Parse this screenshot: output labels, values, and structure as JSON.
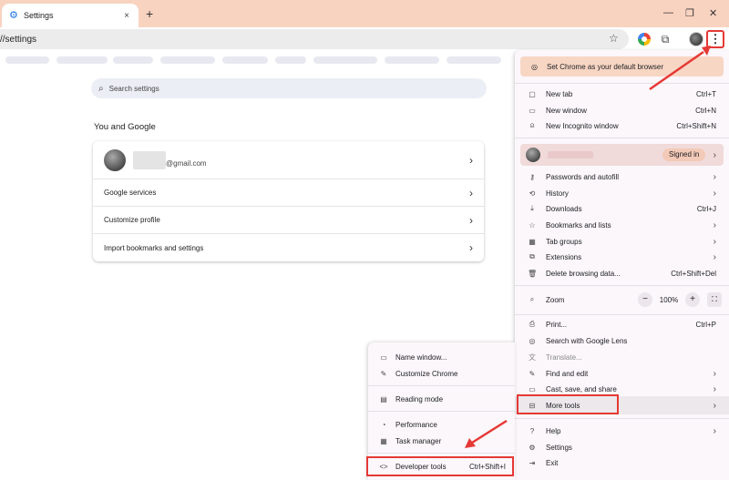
{
  "tab": {
    "title": "Settings",
    "close": "×",
    "new_tab": "+"
  },
  "window_controls": {
    "minimize": "—",
    "restore": "❐",
    "close": "✕"
  },
  "address_bar": {
    "url": "//settings"
  },
  "settings": {
    "search_placeholder": "Search settings",
    "section_title": "You and Google",
    "account_email": "@gmail.com",
    "rows": [
      "Google services",
      "Customize profile",
      "Import bookmarks and settings"
    ]
  },
  "menu": {
    "default_banner": "Set Chrome as your default browser",
    "new_tab": {
      "label": "New tab",
      "shortcut": "Ctrl+T"
    },
    "new_window": {
      "label": "New window",
      "shortcut": "Ctrl+N"
    },
    "incognito": {
      "label": "New Incognito window",
      "shortcut": "Ctrl+Shift+N"
    },
    "signed_in": "Signed in",
    "passwords": "Passwords and autofill",
    "history": "History",
    "downloads": {
      "label": "Downloads",
      "shortcut": "Ctrl+J"
    },
    "bookmarks": "Bookmarks and lists",
    "tab_groups": "Tab groups",
    "extensions": "Extensions",
    "delete_browsing": {
      "label": "Delete browsing data...",
      "shortcut": "Ctrl+Shift+Del"
    },
    "zoom": {
      "label": "Zoom",
      "value": "100%",
      "minus": "−",
      "plus": "+"
    },
    "print": {
      "label": "Print...",
      "shortcut": "Ctrl+P"
    },
    "lens": "Search with Google Lens",
    "translate": "Translate...",
    "find_edit": "Find and edit",
    "cast_save_share": "Cast, save, and share",
    "more_tools": "More tools",
    "help": "Help",
    "settings": "Settings",
    "exit": "Exit"
  },
  "submenu": {
    "name_window": "Name window...",
    "customize_chrome": "Customize Chrome",
    "reading_mode": "Reading mode",
    "performance": "Performance",
    "task_manager": "Task manager",
    "developer_tools": {
      "label": "Developer tools",
      "shortcut": "Ctrl+Shift+I"
    }
  },
  "colors": {
    "accent_highlight": "#e53935",
    "tabstrip": "#f8d3c0"
  },
  "icons": {
    "chevron": "›",
    "settings_gear": "⚙",
    "search": "⌕",
    "star": "☆",
    "puzzle": "⧉",
    "kebab": "⋮",
    "new_tab": "▢",
    "new_window": "▭",
    "incognito": "⍝",
    "key": "⚷",
    "history": "⟲",
    "download": "⤓",
    "bookmark_star": "☆",
    "tab_groups": "▦",
    "extension": "⧉",
    "trash": "🗑",
    "zoom": "⌕",
    "printer": "⎙",
    "lens": "◎",
    "translate": "文",
    "edit": "✎",
    "cast": "▭",
    "toolbox": "⊟",
    "help": "?",
    "settings": "⚙",
    "exit": "⇥",
    "name_window": "▭",
    "customize": "✎",
    "reading": "▤",
    "performance": "◔",
    "task_manager": "▦",
    "devtools": "<>",
    "fullscreen": "⛶"
  }
}
